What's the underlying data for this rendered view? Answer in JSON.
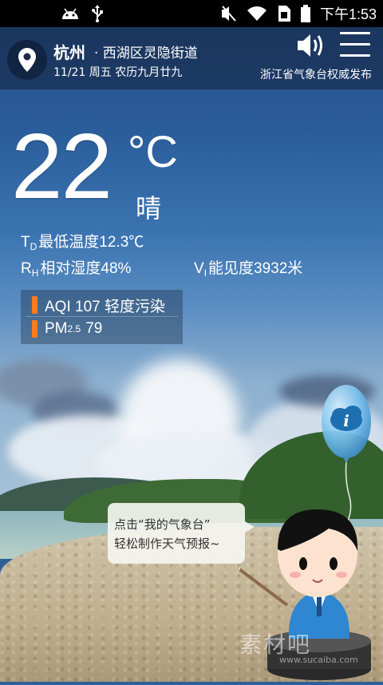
{
  "status_bar": {
    "time": "下午1:53",
    "icons": [
      "android-icon",
      "usb-icon",
      "mute-icon",
      "wifi-icon",
      "sim-icon",
      "battery-icon"
    ]
  },
  "header": {
    "city": "杭州",
    "district": "· 西湖区灵隐街道",
    "date": "11/21 周五  农历九月廿九",
    "publisher": "浙江省气象台权威发布"
  },
  "weather": {
    "temperature": "22",
    "unit": "°C",
    "condition": "晴",
    "min_temp_prefix": "T",
    "min_temp_sub": "D",
    "min_temp_text": "最低温度12.3℃",
    "humidity_prefix": "R",
    "humidity_sub": "H",
    "humidity_text": "相对湿度48%",
    "visibility_prefix": "V",
    "visibility_sub": "I",
    "visibility_text": "能见度3932米"
  },
  "air": {
    "aqi_text": "AQI 107 轻度污染",
    "pm_label": "PM",
    "pm_sub": "2.5",
    "pm_value": "79",
    "accent_color": "#ff7a1a"
  },
  "promo": {
    "line1": "点击“我的气象台”",
    "line2": "轻松制作天气预报~"
  },
  "watermark": {
    "text": "素材吧",
    "url": "www.sucaiba.com"
  }
}
